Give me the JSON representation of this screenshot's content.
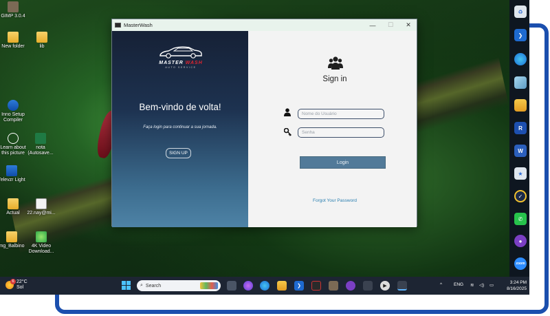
{
  "desktop": {
    "icons": [
      {
        "label": "GIMP 3.0.4"
      },
      {
        "label": "New folder"
      },
      {
        "label": "lib"
      },
      {
        "label": "Inno Setup Compiler"
      },
      {
        "label": "Learn about this picture"
      },
      {
        "label": "nota (Autosave..."
      },
      {
        "label": "Televzr Light"
      },
      {
        "label": "Actual"
      },
      {
        "label": "22.nay@mi..."
      },
      {
        "label": "mg_Balbino"
      },
      {
        "label": "4K Video Download..."
      }
    ]
  },
  "window": {
    "title": "MasterWash",
    "controls": {
      "minimize": "—",
      "maximize": "☐",
      "close": "✕"
    },
    "left_panel": {
      "brand_master": "MASTER",
      "brand_wash": "WASH",
      "brand_sub": "AUTO SERVICE",
      "welcome": "Bem-vindo de volta!",
      "tagline": "Faça login para continuar a sua jornada.",
      "signup_label": "SIGN UP"
    },
    "right_panel": {
      "heading": "Sign in",
      "username_placeholder": "Nome do Usuário",
      "password_placeholder": "Senha",
      "login_label": "Login",
      "forgot_label": "Forgot Your Password"
    }
  },
  "taskbar": {
    "weather_badge": "6",
    "weather_temp": "22°C",
    "weather_cond": "Sol",
    "search_placeholder": "Search",
    "language": "ENG",
    "time": "3:24 PM",
    "date": "8/16/2025"
  },
  "dock": {
    "zoom_label": "zoom",
    "rvt_label": "R"
  }
}
